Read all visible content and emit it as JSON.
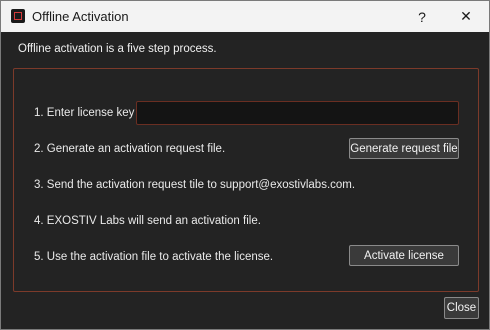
{
  "window": {
    "title": "Offline Activation",
    "help_glyph": "?",
    "close_glyph": "✕"
  },
  "dialog": {
    "intro": "Offline activation is a five step process.",
    "steps": [
      {
        "label": "1.  Enter license key"
      },
      {
        "label": "2.  Generate an activation request file."
      },
      {
        "label": "3.  Send the activation request tile to support@exostivlabs.com."
      },
      {
        "label": "4.  EXOSTIV Labs will send an activation file."
      },
      {
        "label": "5.  Use the activation file to activate the license."
      }
    ],
    "license_key": {
      "value": "",
      "placeholder": ""
    },
    "generate_button": "Generate request file",
    "activate_button": "Activate license",
    "close_button": "Close"
  },
  "colors": {
    "background": "#232323",
    "group_border": "#7c3a2a",
    "input_border": "#6a2e22",
    "titlebar": "#f3f3f3"
  }
}
